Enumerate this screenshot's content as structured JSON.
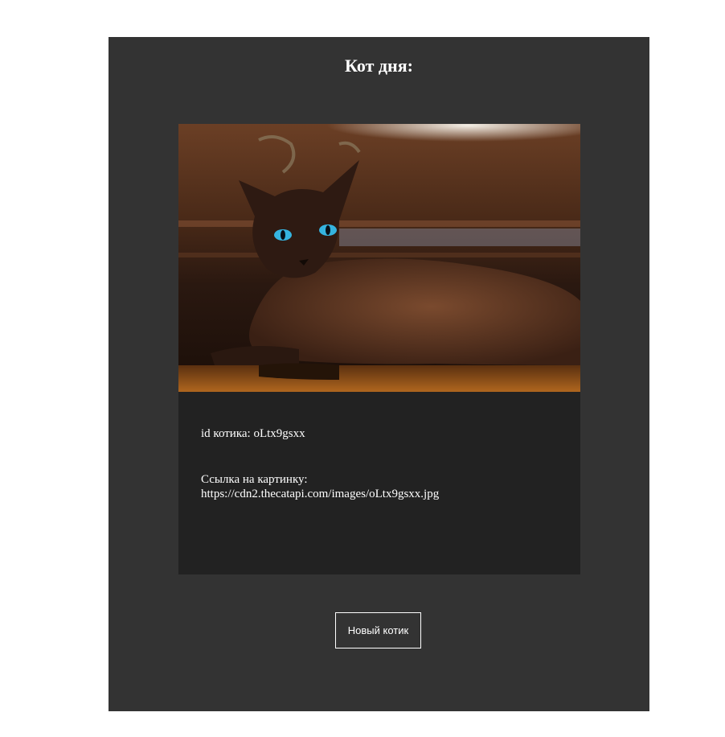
{
  "header": {
    "title": "Кот дня:"
  },
  "cat": {
    "image_alt": "cat photo",
    "id_label": "id котика:",
    "id_value": "oLtx9gsxx",
    "link_label": "Ссылка на картинку:",
    "link_value": "https://cdn2.thecatapi.com/images/oLtx9gsxx.jpg"
  },
  "actions": {
    "new_cat_label": "Новый котик"
  },
  "colors": {
    "page_bg": "#ffffff",
    "panel_bg": "#333333",
    "card_bg": "#222222",
    "text": "#ffffff"
  }
}
